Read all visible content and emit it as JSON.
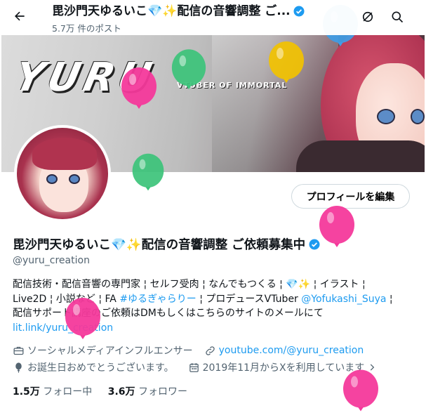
{
  "header": {
    "title": "毘沙門天ゆるいこ💎✨配信の音響調整 ご...",
    "post_count": "5.7万 件のポスト"
  },
  "banner": {
    "logo_text": "YURU",
    "logo_subtitle": "VTUBER OF IMMORTAL"
  },
  "profile": {
    "edit_button": "プロフィールを編集",
    "display_name": "毘沙門天ゆるいこ💎✨配信の音響調整 ご依頼募集中",
    "handle": "@yuru_creation",
    "bio": {
      "line1": "配信技術・配信音響の専門家 ¦ セルフ受肉 ¦ なんでもつくる ¦ 💎✨ ¦ イラスト ¦",
      "line2_a": "Live2D ¦ 小説など ¦ FA ",
      "line2_tag": "#ゆるぎゃらりー",
      "line2_b": " ¦ プロデュースVTuber ",
      "line2_mention": "@Yofukashi_Suya",
      "line2_end": " ¦",
      "line3": "配信サポート講座のご依頼はDMもしくはこちらのサイトのメールにて",
      "link": "lit.link/yuru_creation"
    },
    "category": "ソーシャルメディアインフルエンサー",
    "website": "youtube.com/@yuru_creation",
    "birthday": "お誕生日おめでとうございます。",
    "joined": "2019年11月からXを利用しています",
    "following_count": "1.5万",
    "following_label": "フォロー中",
    "followers_count": "3.6万",
    "followers_label": "フォロワー"
  },
  "colors": {
    "accent": "#1d9bf0",
    "text": "#0f1419",
    "muted": "#536471",
    "balloon_pink": "#f4399b",
    "balloon_green": "#3cc37a",
    "balloon_blue": "#3f9de6",
    "balloon_yellow": "#f2c200"
  },
  "icons": [
    "back-arrow-icon",
    "verified-badge-icon",
    "no-sync-icon",
    "search-icon",
    "briefcase-icon",
    "link-icon",
    "balloon-icon",
    "calendar-icon",
    "chevron-right-icon"
  ]
}
